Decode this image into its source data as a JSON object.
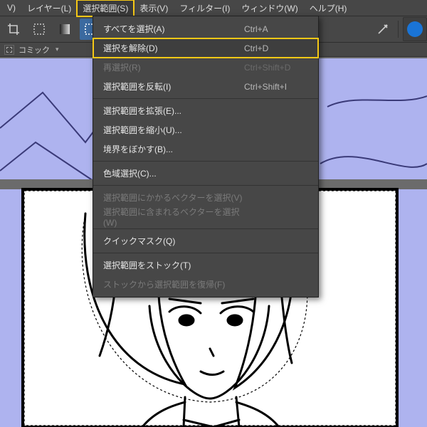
{
  "menubar": {
    "items": [
      {
        "label": "V)"
      },
      {
        "label": "レイヤー(L)"
      },
      {
        "label": "選択範囲(S)",
        "highlighted": true
      },
      {
        "label": "表示(V)"
      },
      {
        "label": "フィルター(I)"
      },
      {
        "label": "ウィンドウ(W)"
      },
      {
        "label": "ヘルプ(H)"
      }
    ]
  },
  "lowerbar": {
    "label": "コミック"
  },
  "menu": {
    "groups": [
      [
        {
          "label": "すべてを選択(A)",
          "shortcut": "Ctrl+A",
          "disabled": false
        },
        {
          "label": "選択を解除(D)",
          "shortcut": "Ctrl+D",
          "disabled": false,
          "highlighted": true
        },
        {
          "label": "再選択(R)",
          "shortcut": "Ctrl+Shift+D",
          "disabled": true
        },
        {
          "label": "選択範囲を反転(I)",
          "shortcut": "Ctrl+Shift+I",
          "disabled": false
        }
      ],
      [
        {
          "label": "選択範囲を拡張(E)...",
          "shortcut": "",
          "disabled": false
        },
        {
          "label": "選択範囲を縮小(U)...",
          "shortcut": "",
          "disabled": false
        },
        {
          "label": "境界をぼかす(B)...",
          "shortcut": "",
          "disabled": false
        }
      ],
      [
        {
          "label": "色域選択(C)...",
          "shortcut": "",
          "disabled": false
        }
      ],
      [
        {
          "label": "選択範囲にかかるベクターを選択(V)",
          "shortcut": "",
          "disabled": true
        },
        {
          "label": "選択範囲に含まれるベクターを選択(W)",
          "shortcut": "",
          "disabled": true
        }
      ],
      [
        {
          "label": "クイックマスク(Q)",
          "shortcut": "",
          "disabled": false
        }
      ],
      [
        {
          "label": "選択範囲をストック(T)",
          "shortcut": "",
          "disabled": false
        },
        {
          "label": "ストックから選択範囲を復帰(F)",
          "shortcut": "",
          "disabled": true
        }
      ]
    ]
  }
}
